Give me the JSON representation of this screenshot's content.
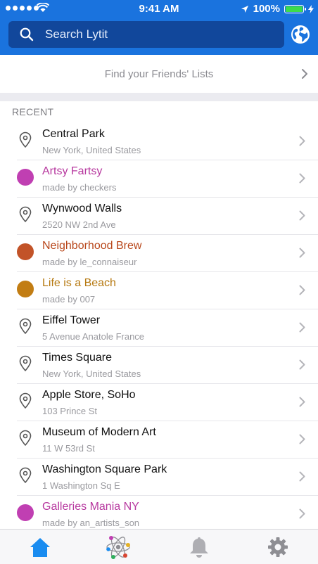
{
  "status_bar": {
    "time": "9:41 AM",
    "battery": "100%"
  },
  "search": {
    "placeholder": "Search Lytit"
  },
  "friends_lists": {
    "label": "Find your Friends' Lists"
  },
  "section": {
    "title": "RECENT"
  },
  "items": [
    {
      "type": "place",
      "title": "Central Park",
      "subtitle": "New York, United States",
      "color": "#111111"
    },
    {
      "type": "list",
      "title": "Artsy Fartsy",
      "subtitle": "made by checkers",
      "color": "#b7389f",
      "dot": "#c03fb2"
    },
    {
      "type": "place",
      "title": "Wynwood Walls",
      "subtitle": "2520 NW 2nd Ave",
      "color": "#111111"
    },
    {
      "type": "list",
      "title": "Neighborhood Brew",
      "subtitle": "made by le_connaiseur",
      "color": "#b8461a",
      "dot": "#c25328"
    },
    {
      "type": "list",
      "title": "Life is a Beach",
      "subtitle": "made by 007",
      "color": "#b67911",
      "dot": "#c27d13"
    },
    {
      "type": "place",
      "title": "Eiffel Tower",
      "subtitle": "5 Avenue Anatole France",
      "color": "#111111"
    },
    {
      "type": "place",
      "title": "Times Square",
      "subtitle": "New York, United States",
      "color": "#111111"
    },
    {
      "type": "place",
      "title": "Apple Store, SoHo",
      "subtitle": "103 Prince St",
      "color": "#111111"
    },
    {
      "type": "place",
      "title": "Museum of Modern Art",
      "subtitle": "11 W 53rd St",
      "color": "#111111"
    },
    {
      "type": "place",
      "title": "Washington Square Park",
      "subtitle": "1 Washington Sq E",
      "color": "#111111"
    },
    {
      "type": "list",
      "title": "Galleries Mania NY",
      "subtitle": "made by an_artists_son",
      "color": "#b7389f",
      "dot": "#c03fb2"
    }
  ],
  "colors": {
    "header": "#1a73de",
    "search_bg": "#11479b",
    "tab_active": "#1a8cf0",
    "tab_inactive": "#8e8e93"
  },
  "tabs": [
    {
      "name": "home",
      "icon": "home-icon",
      "active": true
    },
    {
      "name": "explore",
      "icon": "atom-icon",
      "active": false
    },
    {
      "name": "notifications",
      "icon": "bell-icon",
      "active": false
    },
    {
      "name": "settings",
      "icon": "gear-icon",
      "active": false
    }
  ]
}
